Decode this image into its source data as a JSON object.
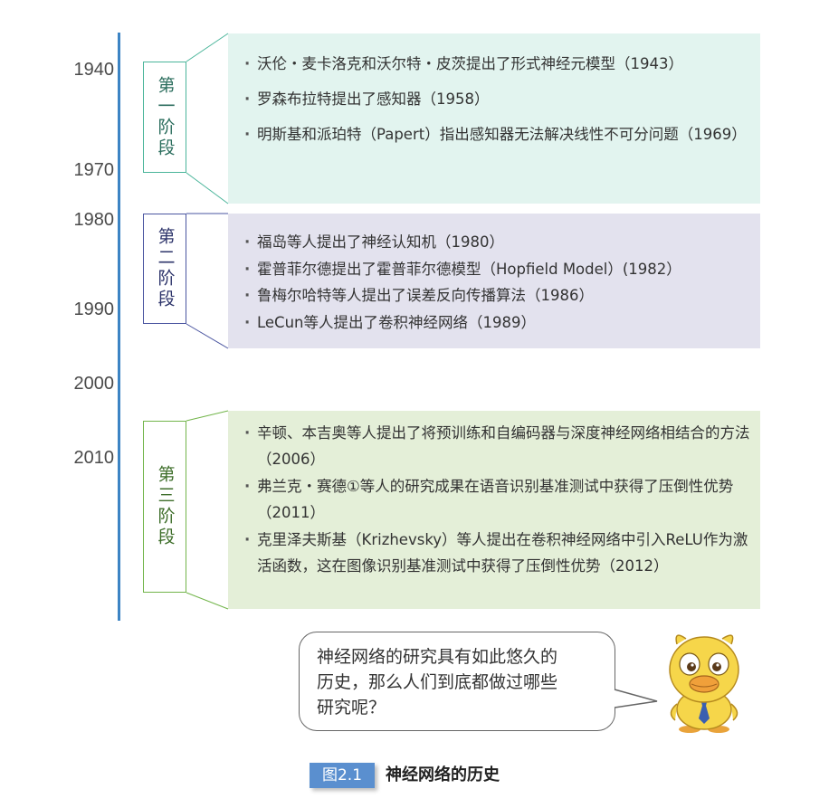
{
  "timeline": {
    "years": [
      "1940",
      "1970",
      "1980",
      "1990",
      "2000",
      "2010"
    ]
  },
  "stages": [
    {
      "label": "第一阶段",
      "items": [
        "沃伦・麦卡洛克和沃尔特・皮茨提出了形式神经元模型（1943）",
        "罗森布拉特提出了感知器（1958）",
        "明斯基和派珀特（Papert）指出感知器无法解决线性不可分问题（1969）"
      ]
    },
    {
      "label": "第二阶段",
      "items": [
        "福岛等人提出了神经认知机（1980）",
        "霍普菲尔德提出了霍普菲尔德模型（Hopfield Model）(1982）",
        "鲁梅尔哈特等人提出了误差反向传播算法（1986）",
        "LeCun等人提出了卷积神经网络（1989）"
      ]
    },
    {
      "label": "第三阶段",
      "items": [
        "辛顿、本吉奥等人提出了将预训练和自编码器与深度神经网络相结合的方法（2006）",
        "弗兰克・赛德①等人的研究成果在语音识别基准测试中获得了压倒性优势（2011）",
        "克里泽夫斯基（Krizhevsky）等人提出在卷积神经网络中引入ReLU作为激活函数，这在图像识别基准测试中获得了压倒性优势（2012）"
      ]
    }
  ],
  "speech_bubble": {
    "lines": [
      "神经网络的研究具有如此悠久的",
      "历史，那么人们到底都做过哪些",
      "研究呢？"
    ]
  },
  "caption": {
    "figure_no": "图2.1",
    "title": "神经网络的历史"
  },
  "colors": {
    "timeline": "#3c84c4",
    "stage1_bg": "#e2f4ef",
    "stage2_bg": "#e3e2ee",
    "stage3_bg": "#e4efd8",
    "caption_badge": "#5a8fcf"
  },
  "icons": {
    "mascot": "yellow-bird-mascot-icon"
  }
}
